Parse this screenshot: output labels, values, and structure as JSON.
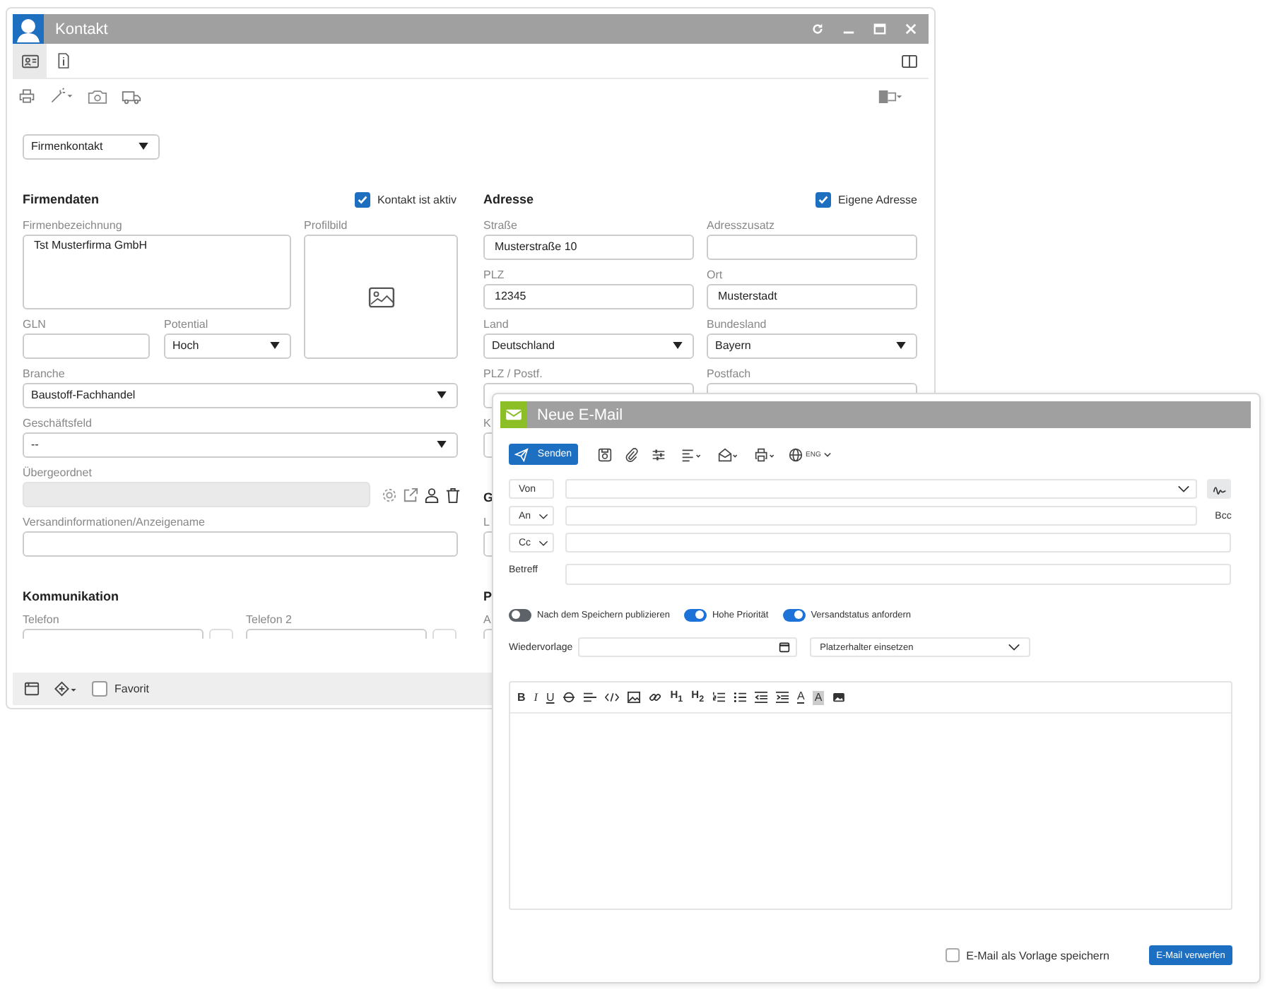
{
  "contact": {
    "title": "Kontakt",
    "tabs": [
      {
        "selected": true
      },
      {
        "selected": false
      }
    ],
    "contact_type": "Firmenkontakt",
    "company": {
      "heading": "Firmendaten",
      "active": {
        "label": "Kontakt ist aktiv",
        "checked": true
      },
      "name": {
        "label": "Firmenbezeichnung",
        "value": "Tst Musterfirma GmbH"
      },
      "picture": {
        "label": "Profilbild"
      },
      "gln": {
        "label": "GLN"
      },
      "potential": {
        "label": "Potential",
        "value": "Hoch"
      },
      "branche": {
        "label": "Branche",
        "value": "Baustoff-Fachhandel"
      },
      "business_field": {
        "label": "Geschäftsfeld",
        "value": "--"
      },
      "parent": {
        "label": "Übergeordnet",
        "disabled": true
      },
      "shipping": {
        "label": "Versandinformationen/Anzeigename"
      }
    },
    "address": {
      "heading": "Adresse",
      "own": {
        "label": "Eigene Adresse",
        "checked": true
      },
      "fields": [
        {
          "label": "Straße",
          "value": "Musterstraße 10",
          "kind": "text"
        },
        {
          "label": "Adresszusatz",
          "kind": "text"
        },
        {
          "label": "PLZ",
          "value": "12345",
          "kind": "text"
        },
        {
          "label": "Ort",
          "value": "Musterstadt",
          "kind": "text"
        },
        {
          "label": "Land",
          "value": "Deutschland",
          "kind": "select"
        },
        {
          "label": "Bundesland",
          "value": "Bayern",
          "kind": "select"
        },
        {
          "label": "PLZ / Postf.",
          "kind": "text"
        },
        {
          "label": "Postfach",
          "kind": "text"
        }
      ]
    },
    "covered": {
      "label_1": "K",
      "heading_1": "G",
      "label_2": "L",
      "heading_2": "P",
      "label_3": "A"
    },
    "communication": {
      "heading": "Kommunikation",
      "fields": [
        {
          "label": "Telefon"
        },
        {
          "label": "Telefon 2"
        }
      ]
    },
    "favorite": {
      "label": "Favorit",
      "checked": false
    }
  },
  "email": {
    "title": "Neue E-Mail",
    "send": "Senden",
    "language": "ENG",
    "from": {
      "label": "Von"
    },
    "to": {
      "label": "An"
    },
    "cc": {
      "label": "Cc"
    },
    "bcc": "Bcc",
    "subject": {
      "label": "Betreff"
    },
    "toggles": [
      {
        "label": "Nach dem Speichern publizieren",
        "on": false
      },
      {
        "label": "Hohe Priorität",
        "on": true
      },
      {
        "label": "Versandstatus anfordern",
        "on": true
      }
    ],
    "followup": {
      "label": "Wiedervorlage"
    },
    "placeholder_select": "Platzerhalter einsetzen",
    "format": {
      "bold": "B",
      "italic": "I",
      "underline": "U",
      "h1": "H$_{1}$",
      "h2": "H$_{2}$",
      "font_color": "A",
      "highlight": "A"
    },
    "save_template": {
      "label": "E-Mail als Vorlage speichern",
      "checked": false
    },
    "discard": "E-Mail verwerfen"
  }
}
